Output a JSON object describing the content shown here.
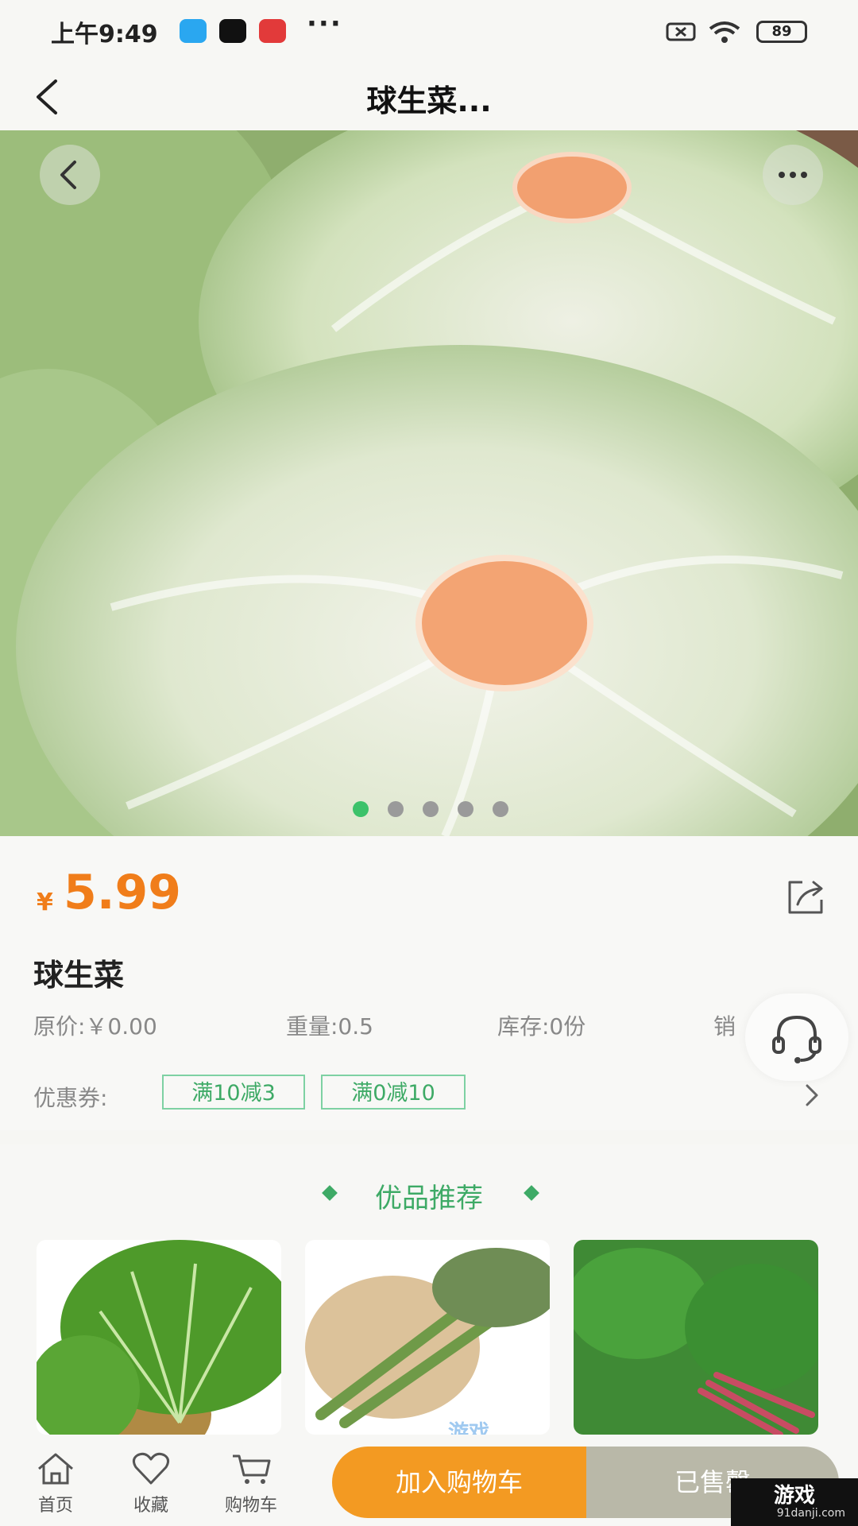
{
  "status_bar": {
    "time": "上午9:49",
    "more": "···",
    "battery": "89"
  },
  "header": {
    "back_icon": "chevron-left-icon",
    "title": "球生菜..."
  },
  "gallery": {
    "dot_count": 5,
    "active_index": 0,
    "accent": "#3cc26a"
  },
  "product": {
    "currency": "¥",
    "price": "5.99",
    "name": "球生菜",
    "original_price": "原价:￥0.00",
    "weight": "重量:0.5",
    "stock": "库存:0份",
    "sales_partial": "销"
  },
  "coupons": {
    "label": "优惠券:",
    "items": [
      "满10减3",
      "满0减10"
    ]
  },
  "recommend": {
    "title": "优品推荐"
  },
  "bottom_bar": {
    "tabs": [
      {
        "label": "首页",
        "icon": "home-icon"
      },
      {
        "label": "收藏",
        "icon": "heart-icon"
      },
      {
        "label": "购物车",
        "icon": "cart-icon"
      }
    ],
    "add_to_cart": "加入购物车",
    "sold_out": "已售罄"
  },
  "watermark": {
    "center_text": "游戏",
    "badge_text": "游戏",
    "site": "91danji.com"
  },
  "colors": {
    "price": "#f07d1a",
    "green": "#3eaa66",
    "cart_btn": "#f39a22",
    "sold_btn": "#b9b8a8"
  }
}
